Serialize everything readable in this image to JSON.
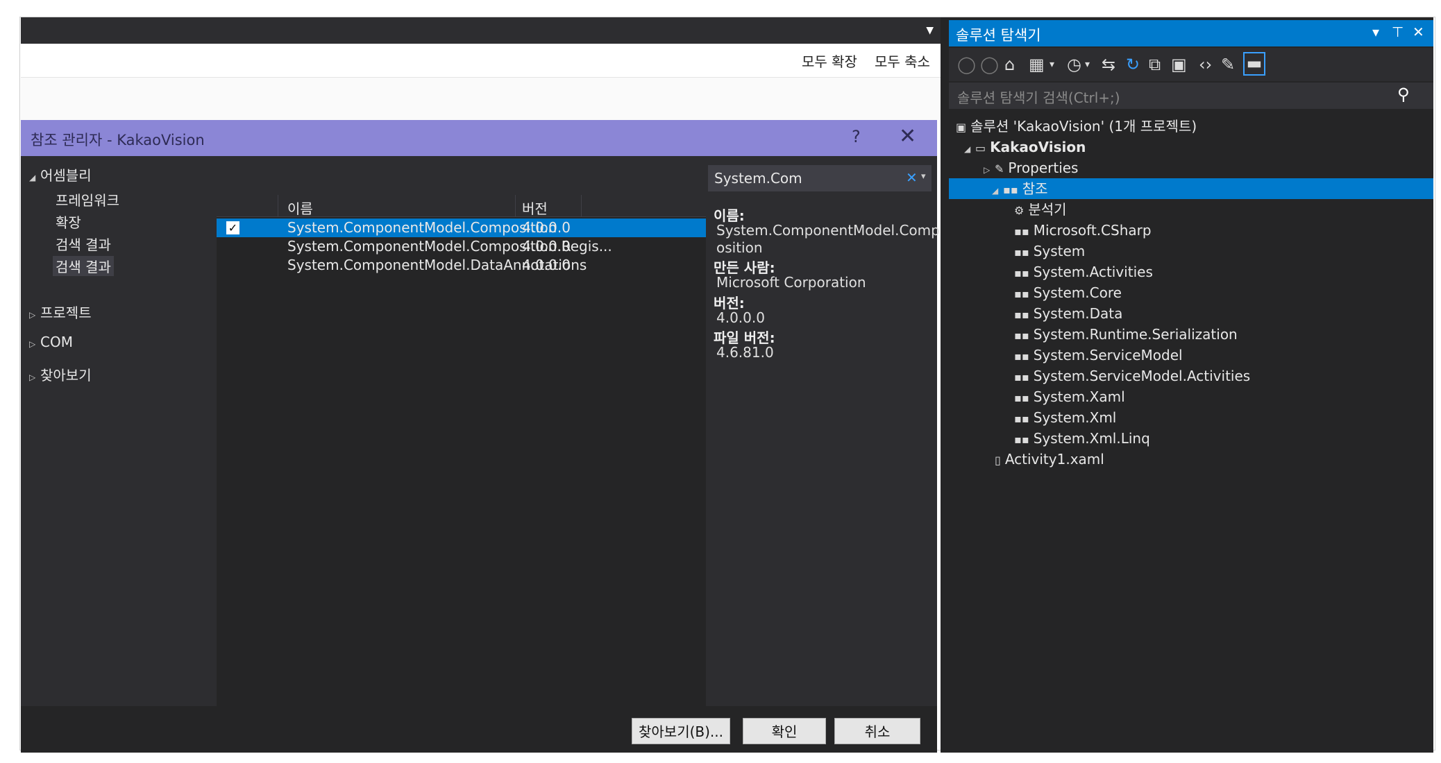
{
  "editor": {
    "expand_all": "모두 확장",
    "collapse_all": "모두 축소",
    "dropdown_icon": "caret-down-icon"
  },
  "dialog": {
    "title": "참조 관리자 - KakaoVision",
    "help": "?",
    "close": "✕",
    "nav": {
      "assemblies": "어셈블리",
      "sub": [
        "프레임워크",
        "확장",
        "검색 결과",
        "검색 결과"
      ],
      "projects": "프로젝트",
      "com": "COM",
      "browse": "찾아보기"
    },
    "grid": {
      "col_name": "이름",
      "col_version": "버전",
      "rows": [
        {
          "name": "System.ComponentModel.Composition",
          "version": "4.0.0.0",
          "checked": true
        },
        {
          "name": "System.ComponentModel.Composition.Regis...",
          "version": "4.0.0.0",
          "checked": false
        },
        {
          "name": "System.ComponentModel.DataAnnotations",
          "version": "4.0.0.0",
          "checked": false
        }
      ]
    },
    "search": {
      "value": "System.Com",
      "clear": "✕",
      "dropdown": "▾"
    },
    "details": {
      "name_label": "이름:",
      "name_line1": "System.ComponentModel.Comp",
      "name_line2": "osition",
      "author_label": "만든 사람:",
      "author": "Microsoft Corporation",
      "version_label": "버전:",
      "version": "4.0.0.0",
      "file_version_label": "파일 버전:",
      "file_version": "4.6.81.0"
    },
    "buttons": {
      "browse": "찾아보기(B)...",
      "ok": "확인",
      "cancel": "취소"
    }
  },
  "solution_explorer": {
    "title": "솔루션 탐색기",
    "pin": "▾ ⊤ ✕",
    "search_placeholder": "솔루션 탐색기 검색(Ctrl+;)",
    "tree": {
      "solution": "솔루션 'KakaoVision' (1개 프로젝트)",
      "project": "KakaoVision",
      "properties": "Properties",
      "references": "참조",
      "analyzers": "분석기",
      "refs": [
        "Microsoft.CSharp",
        "System",
        "System.Activities",
        "System.Core",
        "System.Data",
        "System.Runtime.Serialization",
        "System.ServiceModel",
        "System.ServiceModel.Activities",
        "System.Xaml",
        "System.Xml",
        "System.Xml.Linq"
      ],
      "activity": "Activity1.xaml"
    }
  }
}
